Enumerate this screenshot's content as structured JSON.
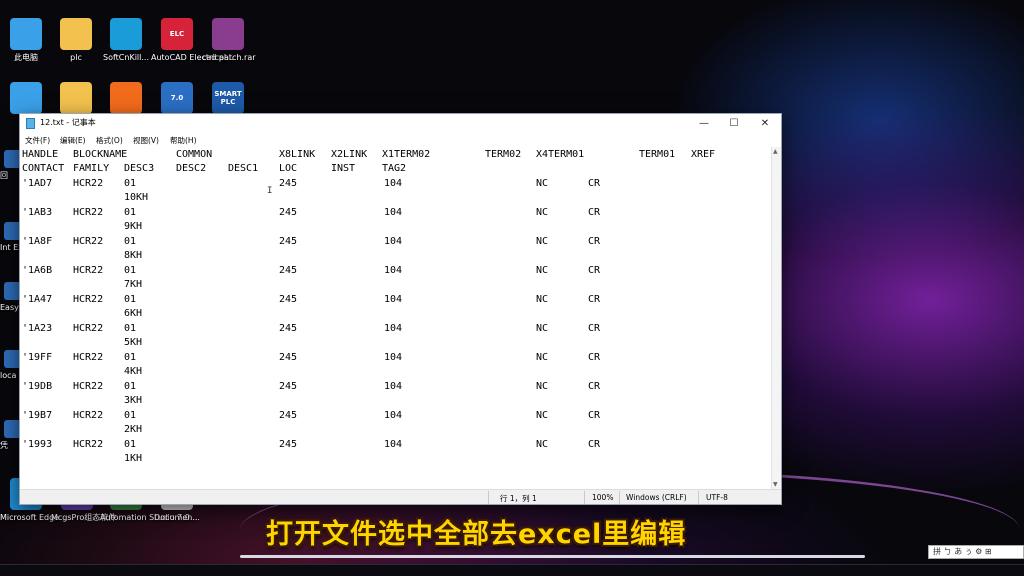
{
  "desktop": {
    "icons_top_row": [
      {
        "label": "此电脑",
        "icon": "computer-icon",
        "color": "#3aa0e8"
      },
      {
        "label": "plc",
        "icon": "folder-icon",
        "color": "#f2c14e"
      },
      {
        "label": "SoftCnKill...",
        "icon": "softcnkill-icon",
        "color": "#1a9cd8"
      },
      {
        "label": "AutoCAD Electrical...",
        "icon": "autocad-electrical-icon",
        "color": "#d6233a",
        "badge": "ELC"
      },
      {
        "label": "cad patch.rar",
        "icon": "winrar-archive-icon",
        "color": "#8a3d8f"
      }
    ],
    "icons_second_row": [
      {
        "label": "",
        "icon": "network-icon",
        "color": "#3aa0e8"
      },
      {
        "label": "",
        "icon": "folder-icon",
        "color": "#f2c14e"
      },
      {
        "label": "",
        "icon": "tool-shortcut-icon",
        "color": "#f26b1d"
      },
      {
        "label": "",
        "icon": "step7-icon",
        "color": "#2a6fc4",
        "badge": "7.0"
      },
      {
        "label": "",
        "icon": "smart-plc-icon",
        "color": "#1d5aa8",
        "badge": "SMART PLC"
      }
    ],
    "left_strip": [
      {
        "label": "回",
        "icon": "recycle-bin-icon"
      },
      {
        "label": "Int Exp",
        "icon": "internet-explorer-icon"
      },
      {
        "label": "Easy",
        "icon": "easy-app-icon"
      },
      {
        "label": "loca",
        "icon": "local-app-icon"
      },
      {
        "label": "凭",
        "icon": "credential-icon"
      }
    ],
    "icons_bottom_row": [
      {
        "label": "Microsoft Edge",
        "icon": "edge-icon"
      },
      {
        "label": "McgsPro组态软件",
        "icon": "mcgspro-icon"
      },
      {
        "label": "Automation Studio 7.0...",
        "icon": "automation-studio-icon"
      },
      {
        "label": "Documen...",
        "icon": "document-icon"
      }
    ]
  },
  "notepad": {
    "title": "12.txt - 记事本",
    "window_buttons": {
      "minimize": "—",
      "maximize": "☐",
      "close": "✕"
    },
    "menu": [
      "文件(F)",
      "编辑(E)",
      "格式(O)",
      "视图(V)",
      "帮助(H)"
    ],
    "header_line1": [
      "HANDLE",
      "BLOCKNAME",
      "COMMON",
      "X8LINK",
      "X2LINK",
      "X1TERM02",
      "TERM02",
      "X4TERM01",
      "TERM01",
      "XREF"
    ],
    "header_line2": [
      "CONTACT",
      "FAMILY",
      "DESC3",
      "DESC2",
      "DESC1",
      "LOC",
      "INST",
      "TAG2"
    ],
    "rows": [
      {
        "handle": "'1AD7",
        "family": "HCR22",
        "desc3": "01",
        "loc": "245",
        "tag2": "104",
        "nc": "NC",
        "cr": "CR",
        "desc3b": "10KH"
      },
      {
        "handle": "'1AB3",
        "family": "HCR22",
        "desc3": "01",
        "loc": "245",
        "tag2": "104",
        "nc": "NC",
        "cr": "CR",
        "desc3b": "9KH"
      },
      {
        "handle": "'1A8F",
        "family": "HCR22",
        "desc3": "01",
        "loc": "245",
        "tag2": "104",
        "nc": "NC",
        "cr": "CR",
        "desc3b": "8KH"
      },
      {
        "handle": "'1A6B",
        "family": "HCR22",
        "desc3": "01",
        "loc": "245",
        "tag2": "104",
        "nc": "NC",
        "cr": "CR",
        "desc3b": "7KH"
      },
      {
        "handle": "'1A47",
        "family": "HCR22",
        "desc3": "01",
        "loc": "245",
        "tag2": "104",
        "nc": "NC",
        "cr": "CR",
        "desc3b": "6KH"
      },
      {
        "handle": "'1A23",
        "family": "HCR22",
        "desc3": "01",
        "loc": "245",
        "tag2": "104",
        "nc": "NC",
        "cr": "CR",
        "desc3b": "5KH"
      },
      {
        "handle": "'19FF",
        "family": "HCR22",
        "desc3": "01",
        "loc": "245",
        "tag2": "104",
        "nc": "NC",
        "cr": "CR",
        "desc3b": "4KH"
      },
      {
        "handle": "'19DB",
        "family": "HCR22",
        "desc3": "01",
        "loc": "245",
        "tag2": "104",
        "nc": "NC",
        "cr": "CR",
        "desc3b": "3KH"
      },
      {
        "handle": "'19B7",
        "family": "HCR22",
        "desc3": "01",
        "loc": "245",
        "tag2": "104",
        "nc": "NC",
        "cr": "CR",
        "desc3b": "2KH"
      },
      {
        "handle": "'1993",
        "family": "HCR22",
        "desc3": "01",
        "loc": "245",
        "tag2": "104",
        "nc": "NC",
        "cr": "CR",
        "desc3b": "1KH"
      }
    ],
    "status": {
      "position": "行 1，列 1",
      "zoom": "100%",
      "line_ending": "Windows (CRLF)",
      "encoding": "UTF-8"
    }
  },
  "caption": "打开文件选中全部去excel里编辑",
  "ime_bar": "拼 ㄅ あ ぅ ⚙ ⊞"
}
